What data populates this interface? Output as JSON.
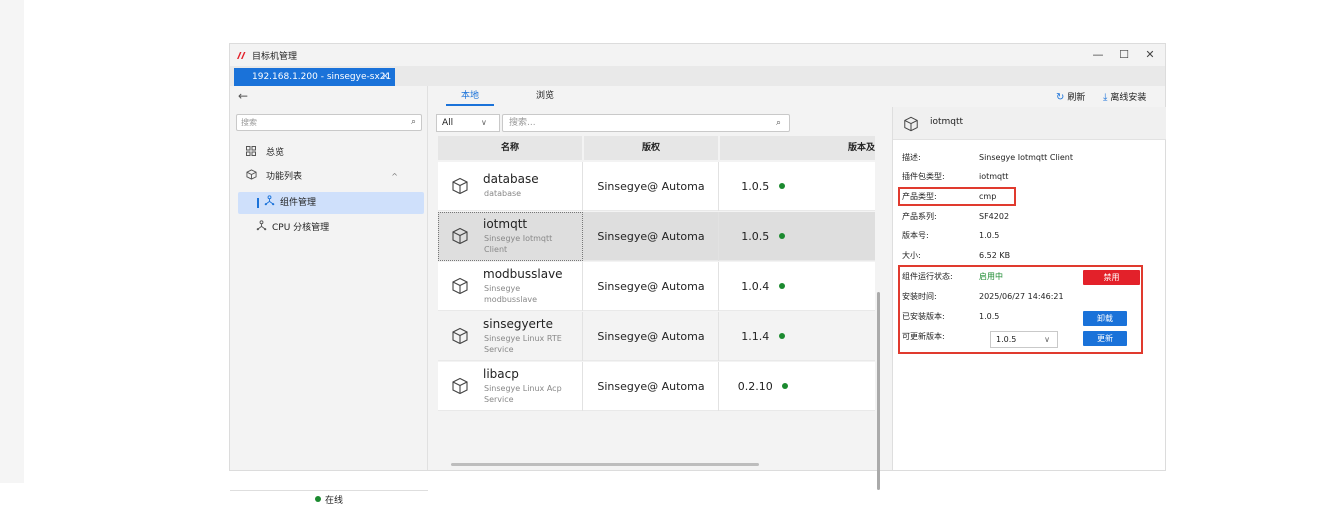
{
  "window": {
    "title": "目标机管理",
    "connection_tab": "192.168.1.200 - sinsegye-sx21",
    "controls": [
      "—",
      "☐",
      "✕"
    ]
  },
  "nav": {
    "back": "←",
    "search_placeholder": "搜索",
    "items": [
      {
        "label": "总览",
        "icon": "grid-icon"
      },
      {
        "label": "功能列表",
        "icon": "cube-icon"
      },
      {
        "label": "组件管理",
        "icon": "component-icon"
      },
      {
        "label": "CPU 分核管理",
        "icon": "component-icon"
      }
    ],
    "status": "在线"
  },
  "tabs": {
    "local": "本地",
    "browse": "浏览"
  },
  "toolbar": {
    "refresh": "刷新",
    "offline_install": "离线安装"
  },
  "filter": {
    "select_value": "All",
    "search_placeholder": "搜索..."
  },
  "table": {
    "headers": [
      "名称",
      "版权",
      "版本及"
    ],
    "rows": [
      {
        "name": "database",
        "desc": [
          "database"
        ],
        "copyright": "Sinsegye@ Automa",
        "version": "1.0.5"
      },
      {
        "name": "iotmqtt",
        "desc": [
          "Sinsegye Iotmqtt",
          "Client"
        ],
        "copyright": "Sinsegye@ Automa",
        "version": "1.0.5"
      },
      {
        "name": "modbusslave",
        "desc": [
          "Sinsegye",
          "modbusslave"
        ],
        "copyright": "Sinsegye@ Automa",
        "version": "1.0.4"
      },
      {
        "name": "sinsegyerte",
        "desc": [
          "Sinsegye Linux RTE",
          "Service"
        ],
        "copyright": "Sinsegye@ Automa",
        "version": "1.1.4"
      },
      {
        "name": "libacp",
        "desc": [
          "Sinsegye Linux Acp",
          "Service"
        ],
        "copyright": "Sinsegye@ Automa",
        "version": "0.2.10"
      }
    ]
  },
  "detail": {
    "title": "iotmqtt",
    "fields": {
      "desc_label": "描述:",
      "desc_value": "Sinsegye Iotmqtt Client",
      "plugin_type_label": "插件包类型:",
      "plugin_type_value": "iotmqtt",
      "product_type_label": "产品类型:",
      "product_type_value": "cmp",
      "product_series_label": "产品系列:",
      "product_series_value": "SF4202",
      "version_label": "版本号:",
      "version_value": "1.0.5",
      "size_label": "大小:",
      "size_value": "6.52 KB",
      "run_state_label": "组件运行状态:",
      "run_state_value": "启用中",
      "install_time_label": "安装时间:",
      "install_time_value": "2025/06/27 14:46:21",
      "installed_version_label": "已安装版本:",
      "installed_version_value": "1.0.5",
      "update_version_label": "可更新版本:",
      "update_version_value": "1.0.5"
    },
    "buttons": {
      "disable": "禁用",
      "uninstall": "卸载",
      "update": "更新"
    }
  },
  "colors": {
    "accent": "#1a72d9",
    "danger": "#e3212a",
    "online": "#1b8a2f",
    "highlight": "#e03a2e"
  }
}
